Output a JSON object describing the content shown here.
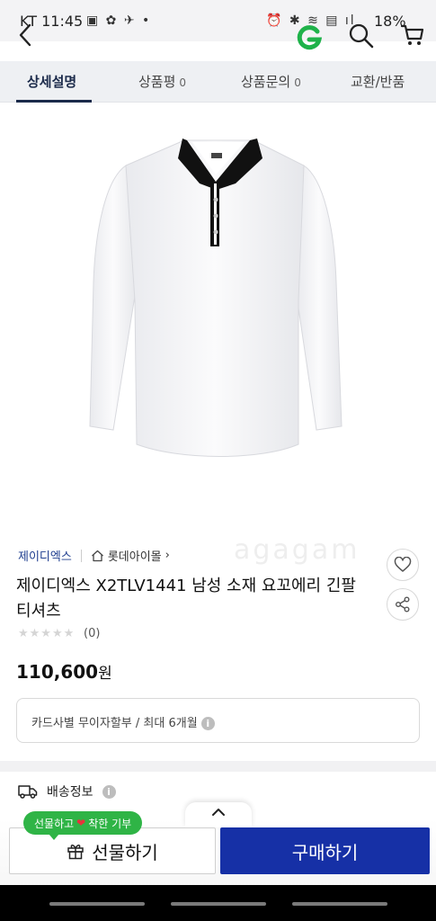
{
  "status_bar": {
    "carrier_time": "KT 11:45",
    "left_icons": "▣ ✿ ✈ •",
    "right_icons": "⏰ ✱ ≋ ▤ ıl",
    "battery": "18%"
  },
  "header": {
    "back_icon": "chevron-left-icon",
    "logo_letter": "G",
    "logo_color": "#1fb24a",
    "search_icon": "search-icon",
    "cart_icon": "cart-icon"
  },
  "tabs": [
    {
      "label": "상세설명",
      "count": ""
    },
    {
      "label": "상품평",
      "count": "0"
    },
    {
      "label": "상품문의",
      "count": "0"
    },
    {
      "label": "교환/반품",
      "count": ""
    }
  ],
  "product": {
    "brand": "제이디엑스",
    "mall": "롯데아이몰",
    "mall_arrow": "›",
    "title": "제이디엑스 X2TLV1441 남성 소재 요꼬에리 긴팔 티셔츠",
    "stars": "★★★★★",
    "review_count": "(0)",
    "price_number": "110,600",
    "price_unit": "원",
    "watermark": "agagam"
  },
  "installment": {
    "text": "카드사별 무이자할부 / 최대 6개월",
    "info": "i"
  },
  "shipping": {
    "label": "배송정보",
    "info": "i"
  },
  "bottom": {
    "gift_badge_pre": "선물하고",
    "gift_badge_heart": "❤",
    "gift_badge_post": "착한 기부",
    "gift_button": "선물하기",
    "buy_button": "구매하기",
    "buy_color": "#1630a6"
  }
}
